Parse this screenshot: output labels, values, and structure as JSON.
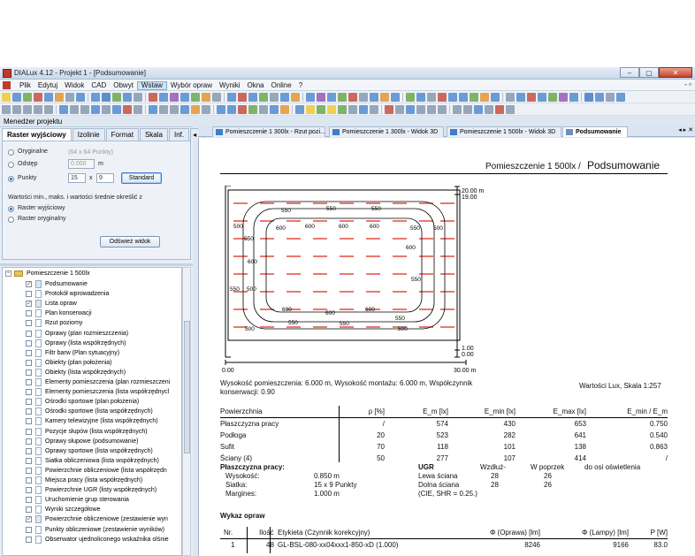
{
  "window": {
    "title": "DIALux 4.12 - Projekt 1 - [Podsumowanie]",
    "minimize": "–",
    "maximize": "▢",
    "close": "✕"
  },
  "menu": {
    "items": [
      "Plik",
      "Edytuj",
      "Widok",
      "CAD",
      "Obwyt",
      "Wstaw",
      "Wybór opraw",
      "Wyniki",
      "Okna",
      "Online",
      "?"
    ],
    "active": "Wstaw",
    "mdi": "- ▫"
  },
  "project_manager": {
    "title": "Menedżer projektu",
    "tabs": [
      "Raster wyjściowy",
      "Izolinie",
      "Format",
      "Skala",
      "Inf."
    ],
    "tab_arrows": "◂ ▸",
    "options": {
      "original_label": "Oryginalne",
      "original_hint": "(64 x 64 Punkty)",
      "spacing_label": "Odstęp",
      "spacing_value": "0.000",
      "spacing_unit": "m",
      "points_label": "Punkty",
      "points_x": "15",
      "points_sep": "x",
      "points_y": "9",
      "standard_button": "Standard",
      "note": "Wartości min., maks. i wartości średnie określić z",
      "raster_out": "Raster wyjściowy",
      "raster_orig": "Raster oryginalny",
      "refresh_button": "Odśwież widok"
    },
    "tree": {
      "root": "Pomieszczenie 1 500lx",
      "items": [
        {
          "label": "Podsumowanie",
          "checked": true
        },
        {
          "label": "Protokół wprowadzenia",
          "checked": false
        },
        {
          "label": "Lista opraw",
          "checked": true
        },
        {
          "label": "Plan konserwacji",
          "checked": false
        },
        {
          "label": "Rzut poziomy",
          "checked": false
        },
        {
          "label": "Oprawy (plan rozmieszczenia)",
          "checked": false
        },
        {
          "label": "Oprawy (lista współrzędnych)",
          "checked": false
        },
        {
          "label": "Filtr barw (Plan sytuacyjny)",
          "checked": false
        },
        {
          "label": "Obiekty (plan położenia)",
          "checked": false
        },
        {
          "label": "Obiekty (lista współrzędnych)",
          "checked": false
        },
        {
          "label": "Elementy pomieszczenia (plan rozmieszczeni",
          "checked": false
        },
        {
          "label": "Elementy pomieszczenia (lista współrzędnycl",
          "checked": false
        },
        {
          "label": "Ośrodki sportowe (plan położenia)",
          "checked": false
        },
        {
          "label": "Ośrodki sportowe (lista współrzędnych)",
          "checked": false
        },
        {
          "label": "Kamery telewizyjne (lista współrzędnych)",
          "checked": false
        },
        {
          "label": "Pozycje słupów (lista współrzędnych)",
          "checked": false
        },
        {
          "label": "Oprawy słupowe (podsumowanie)",
          "checked": false
        },
        {
          "label": "Oprawy sportowe (lista współrzędnych)",
          "checked": false
        },
        {
          "label": "Siatka obliczeniowa (lista współrzędnych)",
          "checked": false
        },
        {
          "label": "Powierzchnie obliczeniowe (lista współrzędn",
          "checked": false
        },
        {
          "label": "Miejsca pracy (lista współrzędnych)",
          "checked": false
        },
        {
          "label": "Powierzchnie UGR (listy współrzędnych)",
          "checked": false
        },
        {
          "label": "Uruchomienie grup sterowania",
          "checked": false
        },
        {
          "label": "Wyniki szczegółowe",
          "checked": false
        },
        {
          "label": "Powierzchnie obliczeniowe (zestawienie wyn",
          "checked": true
        },
        {
          "label": "Punkty obliczeniowe (zestawienie wyników)",
          "checked": false
        },
        {
          "label": "Obserwator ujednoliconego wskaźnika olśnie",
          "checked": false
        }
      ]
    }
  },
  "doc_tabs": [
    {
      "label": "Pomieszczenie 1 300lx - Rzut pozi...",
      "active": false
    },
    {
      "label": "Pomieszczenie 1 300lx - Widok 3D",
      "active": false
    },
    {
      "label": "Pomieszczenie 1 500lx - Widok 3D",
      "active": false
    },
    {
      "label": "Podsumowanie",
      "active": true
    }
  ],
  "doc_tabs_nav": "◂ ▸ ✕",
  "report": {
    "title_small": "Pomieszczenie 1 500lx / ",
    "title_big": "Podsumowanie",
    "plan": {
      "y_top": "20.00 m",
      "y_top2": "19.00",
      "y_bottom": "1.00",
      "y_bottom2": "0.00",
      "x_left": "0.00",
      "x_right": "30.00 m",
      "iso_labels": [
        "500",
        "550",
        "600"
      ]
    },
    "heights_text": "Wysokość pomieszczenia: 6.000 m, Wysokość montażu: 6.000 m, Współczynnik konserwacji: 0.90",
    "lux_scale": "Wartości Lux, Skala 1:257",
    "surf_table": {
      "headers": [
        "Powierzchnia",
        "ρ [%]",
        "E_m [lx]",
        "E_min [lx]",
        "E_max [lx]",
        "E_min / E_m"
      ],
      "rows": [
        [
          "Płaszczyzna pracy",
          "/",
          "574",
          "430",
          "653",
          "0.750"
        ],
        [
          "Podłoga",
          "20",
          "523",
          "282",
          "641",
          "0.540"
        ],
        [
          "Sufit",
          "70",
          "118",
          "101",
          "138",
          "0.863"
        ],
        [
          "Ściany (4)",
          "50",
          "277",
          "107",
          "414",
          "/"
        ]
      ]
    },
    "workplane": {
      "title": "Płaszczyzna pracy:",
      "rows": [
        [
          "Wysokość:",
          "0.850 m"
        ],
        [
          "Siatka:",
          "15 x 9 Punkty"
        ],
        [
          "Margines:",
          "1.000 m"
        ]
      ],
      "ugr_title": "UGR",
      "ugr_col1": "Wzdłuż-",
      "ugr_col2": "W poprzek",
      "ugr_col3": "do osi oświetlenia",
      "ugr_rows": [
        [
          "Lewa ściana",
          "28",
          "26"
        ],
        [
          "Dolna ściana",
          "28",
          "26"
        ]
      ],
      "ugr_note": "(CIE, SHR = 0.25.)"
    },
    "lum_list": {
      "title": "Wykaz opraw",
      "headers": [
        "Nr.",
        "Ilość",
        "Etykieta (Czynnik korekcyjny)",
        "Φ (Oprawa) [lm]",
        "Φ (Lampy) [lm]",
        "P [W]"
      ],
      "rows": [
        [
          "1",
          "48",
          "GL-BSL-080-xx04xxx1-850-xD (1.000)",
          "8246",
          "9166",
          "83.0"
        ]
      ]
    }
  }
}
